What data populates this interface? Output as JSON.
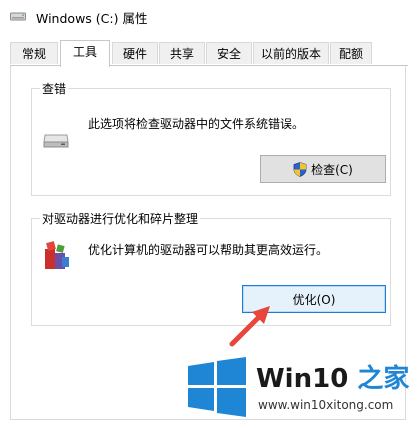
{
  "window": {
    "title": "Windows (C:) 属性"
  },
  "tabs": [
    {
      "label": "常规",
      "active": false
    },
    {
      "label": "工具",
      "active": true
    },
    {
      "label": "硬件",
      "active": false
    },
    {
      "label": "共享",
      "active": false
    },
    {
      "label": "安全",
      "active": false
    },
    {
      "label": "以前的版本",
      "active": false
    },
    {
      "label": "配额",
      "active": false
    }
  ],
  "error_check": {
    "title": "查错",
    "description": "此选项将检查驱动器中的文件系统错误。",
    "button_label": "检查(C)",
    "button_icon": "uac-shield-icon"
  },
  "optimize": {
    "title": "对驱动器进行优化和碎片整理",
    "description": "优化计算机的驱动器可以帮助其更高效运行。",
    "button_label": "优化(O)",
    "button_icon": "defrag-icon"
  },
  "watermark": {
    "brand_prefix": "Win10",
    "brand_suffix": "之家",
    "url": "www.win10xitong.com"
  },
  "colors": {
    "accent": "#1e7cd8",
    "arrow": "#e8453c",
    "logo_blue": "#1f86d6"
  }
}
